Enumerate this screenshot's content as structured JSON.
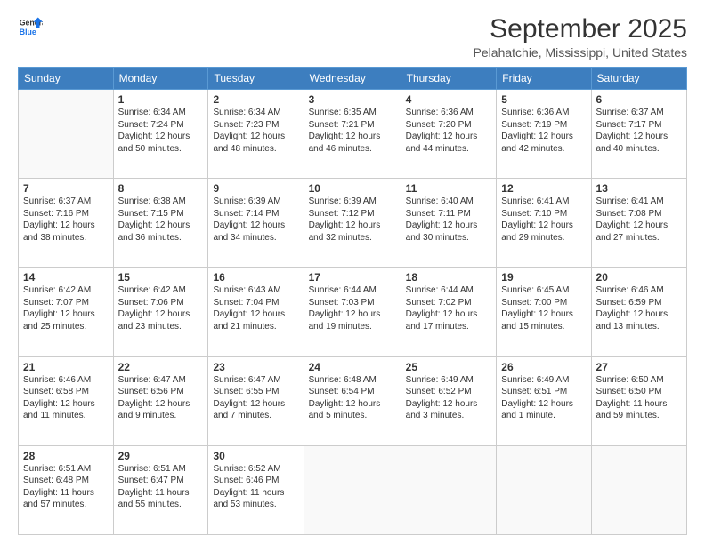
{
  "logo": {
    "line1": "General",
    "line2": "Blue"
  },
  "title": "September 2025",
  "subtitle": "Pelahatchie, Mississippi, United States",
  "days_of_week": [
    "Sunday",
    "Monday",
    "Tuesday",
    "Wednesday",
    "Thursday",
    "Friday",
    "Saturday"
  ],
  "weeks": [
    [
      {
        "day": "",
        "sunrise": "",
        "sunset": "",
        "daylight": ""
      },
      {
        "day": "1",
        "sunrise": "Sunrise: 6:34 AM",
        "sunset": "Sunset: 7:24 PM",
        "daylight": "Daylight: 12 hours and 50 minutes."
      },
      {
        "day": "2",
        "sunrise": "Sunrise: 6:34 AM",
        "sunset": "Sunset: 7:23 PM",
        "daylight": "Daylight: 12 hours and 48 minutes."
      },
      {
        "day": "3",
        "sunrise": "Sunrise: 6:35 AM",
        "sunset": "Sunset: 7:21 PM",
        "daylight": "Daylight: 12 hours and 46 minutes."
      },
      {
        "day": "4",
        "sunrise": "Sunrise: 6:36 AM",
        "sunset": "Sunset: 7:20 PM",
        "daylight": "Daylight: 12 hours and 44 minutes."
      },
      {
        "day": "5",
        "sunrise": "Sunrise: 6:36 AM",
        "sunset": "Sunset: 7:19 PM",
        "daylight": "Daylight: 12 hours and 42 minutes."
      },
      {
        "day": "6",
        "sunrise": "Sunrise: 6:37 AM",
        "sunset": "Sunset: 7:17 PM",
        "daylight": "Daylight: 12 hours and 40 minutes."
      }
    ],
    [
      {
        "day": "7",
        "sunrise": "Sunrise: 6:37 AM",
        "sunset": "Sunset: 7:16 PM",
        "daylight": "Daylight: 12 hours and 38 minutes."
      },
      {
        "day": "8",
        "sunrise": "Sunrise: 6:38 AM",
        "sunset": "Sunset: 7:15 PM",
        "daylight": "Daylight: 12 hours and 36 minutes."
      },
      {
        "day": "9",
        "sunrise": "Sunrise: 6:39 AM",
        "sunset": "Sunset: 7:14 PM",
        "daylight": "Daylight: 12 hours and 34 minutes."
      },
      {
        "day": "10",
        "sunrise": "Sunrise: 6:39 AM",
        "sunset": "Sunset: 7:12 PM",
        "daylight": "Daylight: 12 hours and 32 minutes."
      },
      {
        "day": "11",
        "sunrise": "Sunrise: 6:40 AM",
        "sunset": "Sunset: 7:11 PM",
        "daylight": "Daylight: 12 hours and 30 minutes."
      },
      {
        "day": "12",
        "sunrise": "Sunrise: 6:41 AM",
        "sunset": "Sunset: 7:10 PM",
        "daylight": "Daylight: 12 hours and 29 minutes."
      },
      {
        "day": "13",
        "sunrise": "Sunrise: 6:41 AM",
        "sunset": "Sunset: 7:08 PM",
        "daylight": "Daylight: 12 hours and 27 minutes."
      }
    ],
    [
      {
        "day": "14",
        "sunrise": "Sunrise: 6:42 AM",
        "sunset": "Sunset: 7:07 PM",
        "daylight": "Daylight: 12 hours and 25 minutes."
      },
      {
        "day": "15",
        "sunrise": "Sunrise: 6:42 AM",
        "sunset": "Sunset: 7:06 PM",
        "daylight": "Daylight: 12 hours and 23 minutes."
      },
      {
        "day": "16",
        "sunrise": "Sunrise: 6:43 AM",
        "sunset": "Sunset: 7:04 PM",
        "daylight": "Daylight: 12 hours and 21 minutes."
      },
      {
        "day": "17",
        "sunrise": "Sunrise: 6:44 AM",
        "sunset": "Sunset: 7:03 PM",
        "daylight": "Daylight: 12 hours and 19 minutes."
      },
      {
        "day": "18",
        "sunrise": "Sunrise: 6:44 AM",
        "sunset": "Sunset: 7:02 PM",
        "daylight": "Daylight: 12 hours and 17 minutes."
      },
      {
        "day": "19",
        "sunrise": "Sunrise: 6:45 AM",
        "sunset": "Sunset: 7:00 PM",
        "daylight": "Daylight: 12 hours and 15 minutes."
      },
      {
        "day": "20",
        "sunrise": "Sunrise: 6:46 AM",
        "sunset": "Sunset: 6:59 PM",
        "daylight": "Daylight: 12 hours and 13 minutes."
      }
    ],
    [
      {
        "day": "21",
        "sunrise": "Sunrise: 6:46 AM",
        "sunset": "Sunset: 6:58 PM",
        "daylight": "Daylight: 12 hours and 11 minutes."
      },
      {
        "day": "22",
        "sunrise": "Sunrise: 6:47 AM",
        "sunset": "Sunset: 6:56 PM",
        "daylight": "Daylight: 12 hours and 9 minutes."
      },
      {
        "day": "23",
        "sunrise": "Sunrise: 6:47 AM",
        "sunset": "Sunset: 6:55 PM",
        "daylight": "Daylight: 12 hours and 7 minutes."
      },
      {
        "day": "24",
        "sunrise": "Sunrise: 6:48 AM",
        "sunset": "Sunset: 6:54 PM",
        "daylight": "Daylight: 12 hours and 5 minutes."
      },
      {
        "day": "25",
        "sunrise": "Sunrise: 6:49 AM",
        "sunset": "Sunset: 6:52 PM",
        "daylight": "Daylight: 12 hours and 3 minutes."
      },
      {
        "day": "26",
        "sunrise": "Sunrise: 6:49 AM",
        "sunset": "Sunset: 6:51 PM",
        "daylight": "Daylight: 12 hours and 1 minute."
      },
      {
        "day": "27",
        "sunrise": "Sunrise: 6:50 AM",
        "sunset": "Sunset: 6:50 PM",
        "daylight": "Daylight: 11 hours and 59 minutes."
      }
    ],
    [
      {
        "day": "28",
        "sunrise": "Sunrise: 6:51 AM",
        "sunset": "Sunset: 6:48 PM",
        "daylight": "Daylight: 11 hours and 57 minutes."
      },
      {
        "day": "29",
        "sunrise": "Sunrise: 6:51 AM",
        "sunset": "Sunset: 6:47 PM",
        "daylight": "Daylight: 11 hours and 55 minutes."
      },
      {
        "day": "30",
        "sunrise": "Sunrise: 6:52 AM",
        "sunset": "Sunset: 6:46 PM",
        "daylight": "Daylight: 11 hours and 53 minutes."
      },
      {
        "day": "",
        "sunrise": "",
        "sunset": "",
        "daylight": ""
      },
      {
        "day": "",
        "sunrise": "",
        "sunset": "",
        "daylight": ""
      },
      {
        "day": "",
        "sunrise": "",
        "sunset": "",
        "daylight": ""
      },
      {
        "day": "",
        "sunrise": "",
        "sunset": "",
        "daylight": ""
      }
    ]
  ]
}
